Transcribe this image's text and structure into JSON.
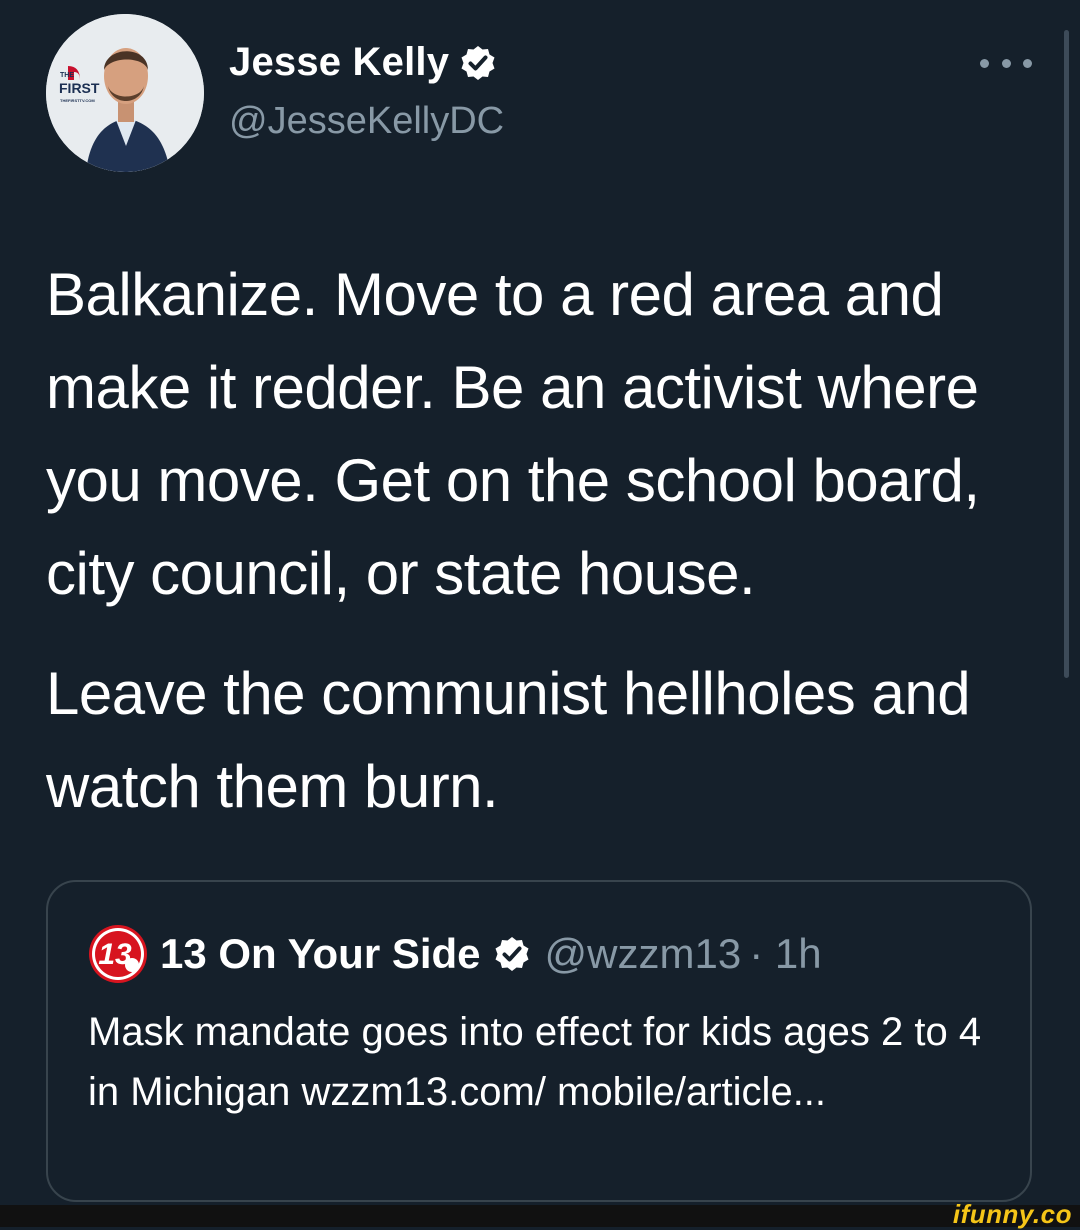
{
  "author": {
    "display_name": "Jesse Kelly",
    "handle": "@JesseKellyDC",
    "avatar_badge": {
      "top": "THE",
      "main": "FIRST",
      "sub": "THEFIRSTTV.COM"
    },
    "verified": true
  },
  "tweet": {
    "paragraphs": [
      "Balkanize. Move to a red area and make it redder. Be an activist where you move. Get on the school board, city council, or state house.",
      "Leave the communist hellholes and watch them burn."
    ]
  },
  "quoted_tweet": {
    "logo_text": "13",
    "display_name": "13 On Your Side",
    "handle": "@wzzm13",
    "time": "· 1h",
    "verified": true,
    "text": "Mask mandate goes into effect for kids ages 2 to 4 in Michigan wzzm13.com/ mobile/article..."
  },
  "icons": {
    "verified": "verified-badge-icon",
    "more": "more-dots-icon"
  },
  "watermark": "ifunny.co",
  "colors": {
    "background": "#15202b",
    "text": "#ffffff",
    "secondary": "#8899a6",
    "border": "#38444d",
    "watermark": "#f5c518"
  }
}
